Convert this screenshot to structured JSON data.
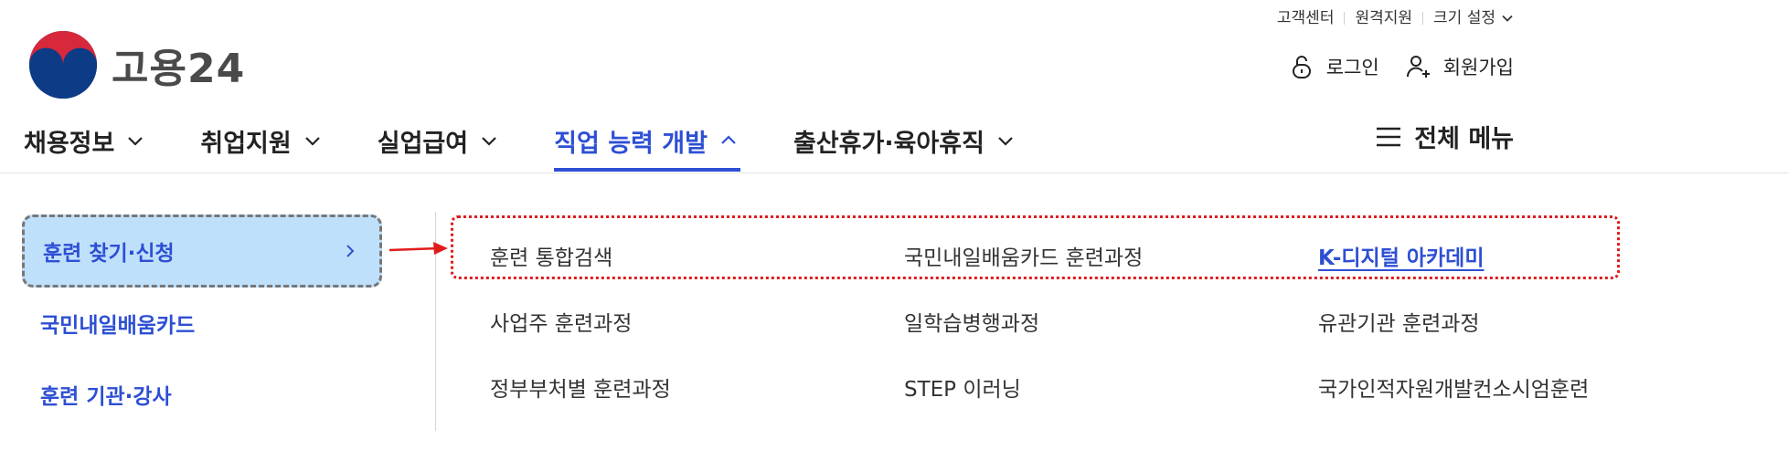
{
  "utility": {
    "customer_center": "고객센터",
    "remote_support": "원격지원",
    "text_size": "크기 설정"
  },
  "logo": {
    "text": "고용24"
  },
  "account": {
    "login": "로그인",
    "signup": "회원가입"
  },
  "gnb": {
    "items": [
      {
        "label": "채용정보"
      },
      {
        "label": "취업지원"
      },
      {
        "label": "실업급여"
      },
      {
        "label": "직업 능력 개발"
      },
      {
        "label": "출산휴가·육아휴직"
      }
    ],
    "all_menu": "전체 메뉴",
    "active_index": 3
  },
  "submenu": {
    "items": [
      {
        "label": "훈련 찾기·신청"
      },
      {
        "label": "국민내일배움카드"
      },
      {
        "label": "훈련 기관·강사"
      }
    ],
    "active_index": 0
  },
  "links": [
    [
      "훈련 통합검색",
      "국민내일배움카드 훈련과정",
      "K-디지털 아카데미"
    ],
    [
      "사업주 훈련과정",
      "일학습병행과정",
      "유관기관 훈련과정"
    ],
    [
      "정부부처별 훈련과정",
      "STEP 이러닝",
      "국가인적자원개발컨소시엄훈련"
    ]
  ],
  "colors": {
    "accent": "#2d4fd4",
    "active_bg": "#bfe0fb",
    "annotation_red": "#e11b1b"
  }
}
